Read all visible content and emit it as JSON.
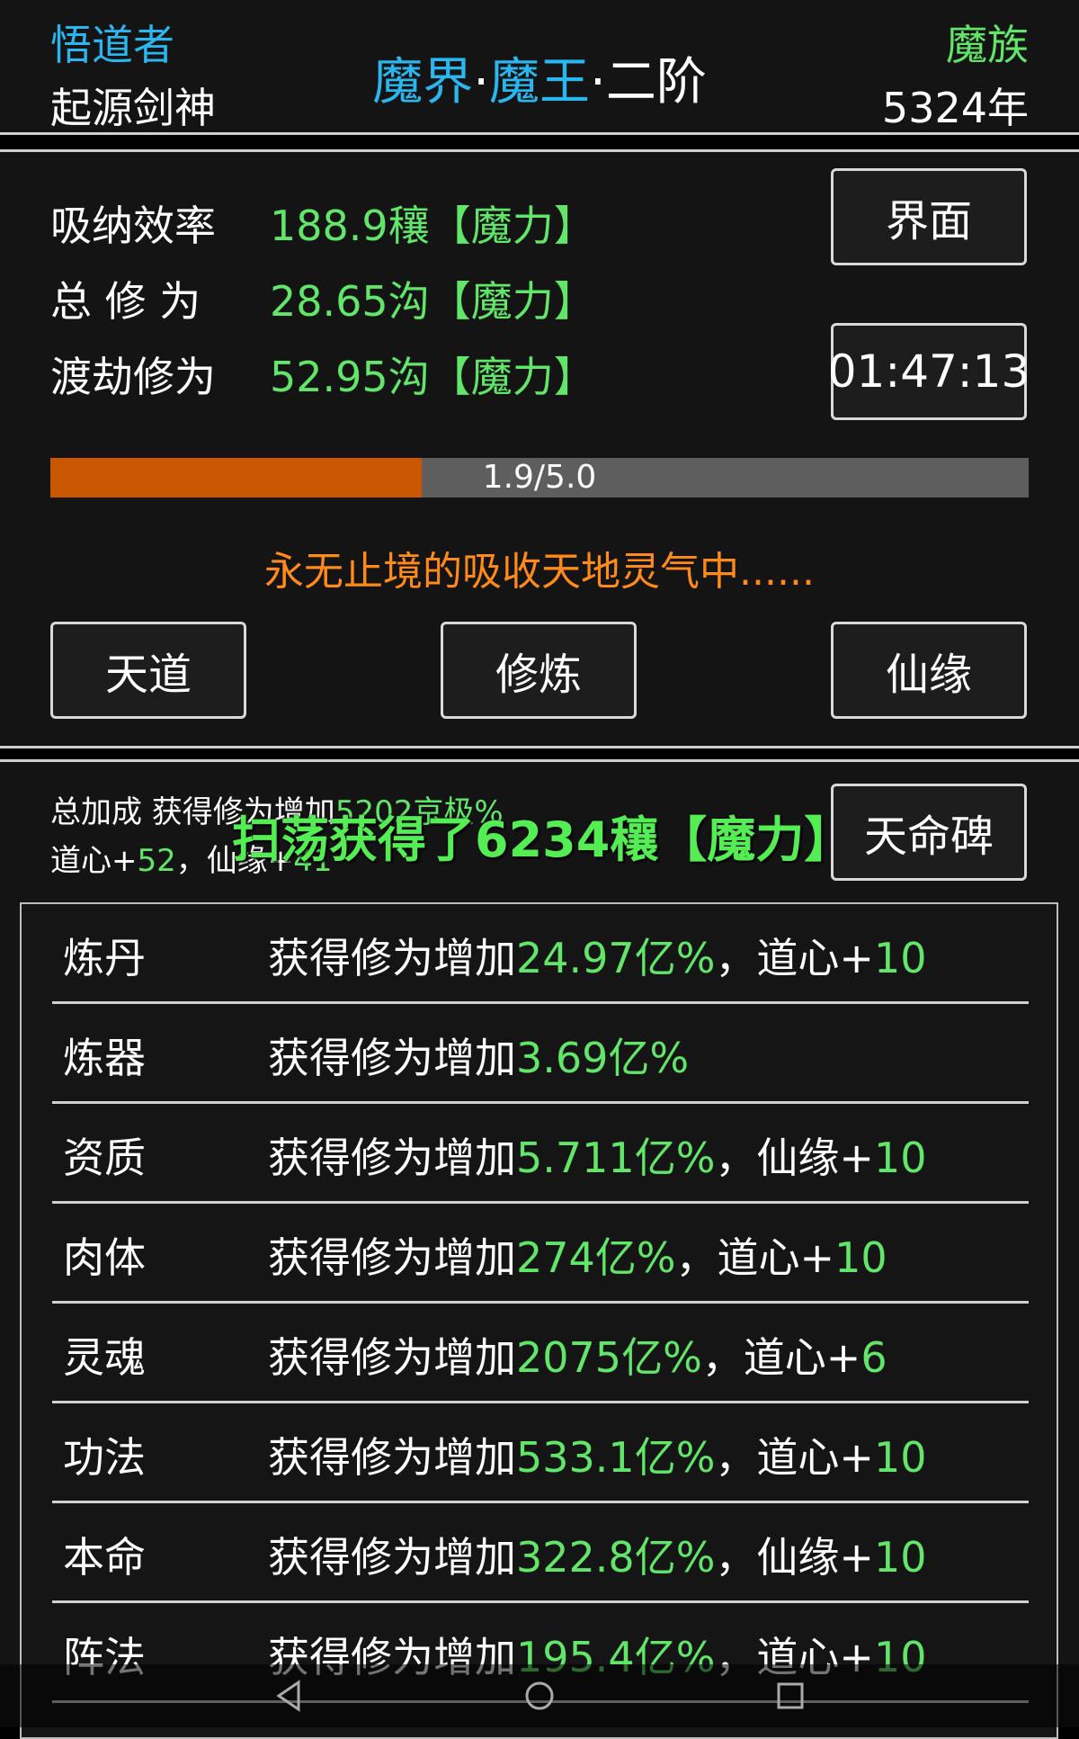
{
  "header": {
    "role": "悟道者",
    "name": "起源剑神",
    "realm_a": "魔界",
    "dot1": "·",
    "realm_b": "魔王",
    "dot2": "·",
    "realm_c": "二阶",
    "race": "魔族",
    "years": "5324年"
  },
  "stats": {
    "rows": [
      {
        "label": "吸纳效率",
        "value": "188.9穰【魔力】"
      },
      {
        "label": "总 修 为",
        "value": "28.65沟【魔力】"
      },
      {
        "label": "渡劫修为",
        "value": "52.95沟【魔力】"
      }
    ],
    "interface_button": "界面",
    "timer": "01:47:13"
  },
  "progress": {
    "text": "1.9/5.0",
    "fraction": 0.38
  },
  "status_text": "永无止境的吸收天地灵气中......",
  "actions": {
    "tiandao": "天道",
    "xiulian": "修炼",
    "xianyuan": "仙缘"
  },
  "bonus": {
    "line1_prefix": "总加成 获得修为增加",
    "line1_value": "5202京极",
    "line1_suffix": "%",
    "line2_a": "道心+",
    "line2_a_val": "52",
    "line2_sep": "，仙缘+",
    "line2_b_val": "41"
  },
  "toast": "扫荡获得了6234穰【魔力】",
  "tianming_button": "天命碑",
  "items": [
    {
      "name": "炼丹",
      "prefix": "获得修为增加",
      "value": "24.97亿%",
      "attr": "，道心+",
      "attr_val": "10"
    },
    {
      "name": "炼器",
      "prefix": "获得修为增加",
      "value": "3.69亿%",
      "attr": "",
      "attr_val": ""
    },
    {
      "name": "资质",
      "prefix": "获得修为增加",
      "value": "5.711亿%",
      "attr": "，仙缘+",
      "attr_val": "10"
    },
    {
      "name": "肉体",
      "prefix": "获得修为增加",
      "value": "274亿%",
      "attr": "，道心+",
      "attr_val": "10"
    },
    {
      "name": "灵魂",
      "prefix": "获得修为增加",
      "value": "2075亿%",
      "attr": "，道心+",
      "attr_val": "6"
    },
    {
      "name": "功法",
      "prefix": "获得修为增加",
      "value": "533.1亿%",
      "attr": "，道心+",
      "attr_val": "10"
    },
    {
      "name": "本命",
      "prefix": "获得修为增加",
      "value": "322.8亿%",
      "attr": "，仙缘+",
      "attr_val": "10"
    },
    {
      "name": "阵法",
      "prefix": "获得修为增加",
      "value": "195.4亿%",
      "attr": "，道心+",
      "attr_val": "10"
    }
  ],
  "colors": {
    "accent_blue": "#2ab6ee",
    "value_green": "#62e66a",
    "progress_fill": "#c95600",
    "status_orange": "#ff8a1a"
  }
}
